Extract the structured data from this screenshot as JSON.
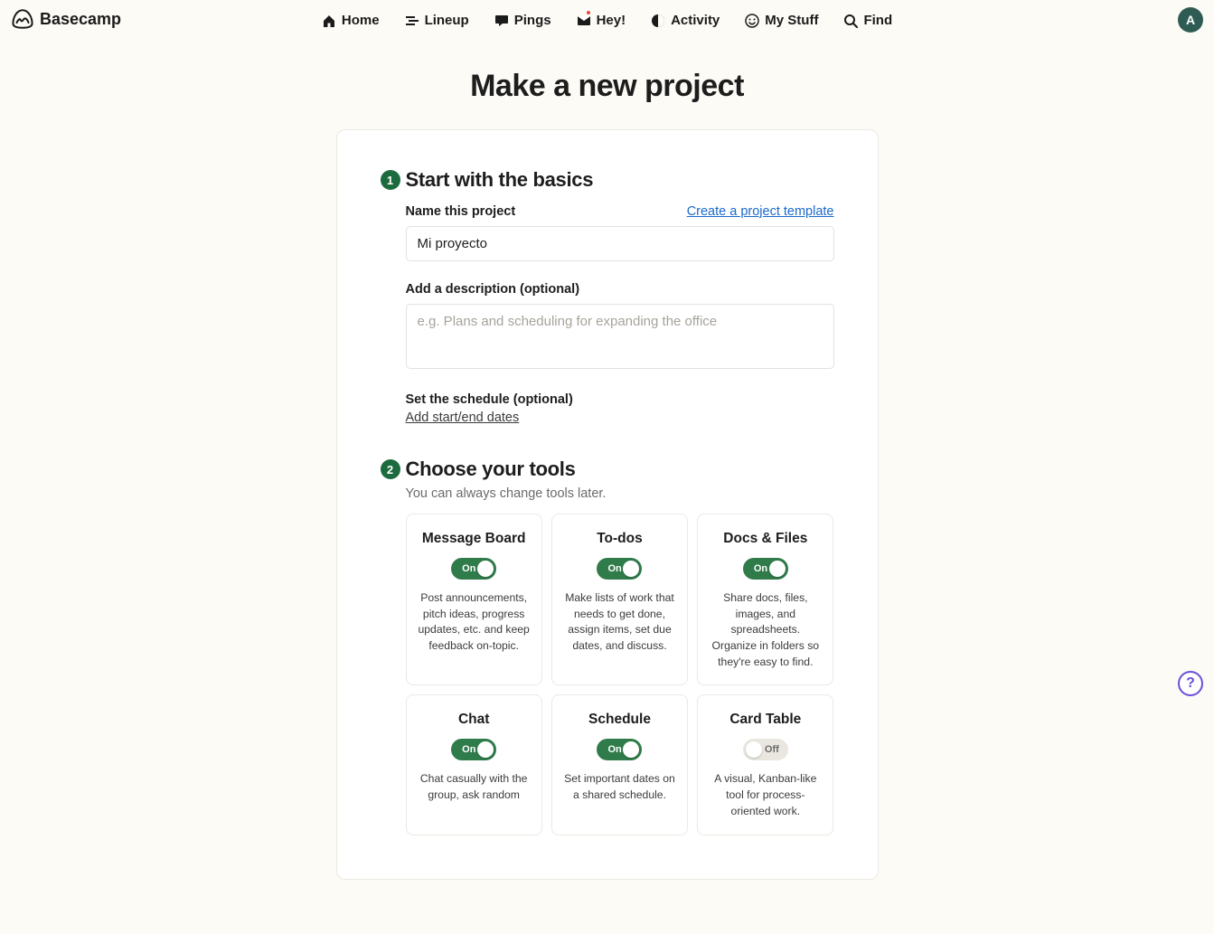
{
  "logo_text": "Basecamp",
  "nav": {
    "home": "Home",
    "lineup": "Lineup",
    "pings": "Pings",
    "hey": "Hey!",
    "activity": "Activity",
    "mystuff": "My Stuff",
    "find": "Find"
  },
  "avatar_initial": "A",
  "page_title": "Make a new project",
  "step1": {
    "num": "1",
    "heading": "Start with the basics",
    "name_label": "Name this project",
    "template_link": "Create a project template",
    "name_value": "Mi proyecto",
    "desc_label": "Add a description (optional)",
    "desc_placeholder": "e.g. Plans and scheduling for expanding the office",
    "schedule_label": "Set the schedule (optional)",
    "dates_link": "Add start/end dates"
  },
  "step2": {
    "num": "2",
    "heading": "Choose your tools",
    "sub": "You can always change tools later.",
    "on_label": "On",
    "off_label": "Off",
    "tools": [
      {
        "title": "Message Board",
        "on": true,
        "desc": "Post announcements, pitch ideas, progress updates, etc. and keep feedback on-topic."
      },
      {
        "title": "To-dos",
        "on": true,
        "desc": "Make lists of work that needs to get done, assign items, set due dates, and discuss."
      },
      {
        "title": "Docs & Files",
        "on": true,
        "desc": "Share docs, files, images, and spreadsheets. Organize in folders so they're easy to find."
      },
      {
        "title": "Chat",
        "on": true,
        "desc": "Chat casually with the group, ask random"
      },
      {
        "title": "Schedule",
        "on": true,
        "desc": "Set important dates on a shared schedule."
      },
      {
        "title": "Card Table",
        "on": false,
        "desc": "A visual, Kanban-like tool for process-oriented work."
      }
    ]
  },
  "help_glyph": "?"
}
